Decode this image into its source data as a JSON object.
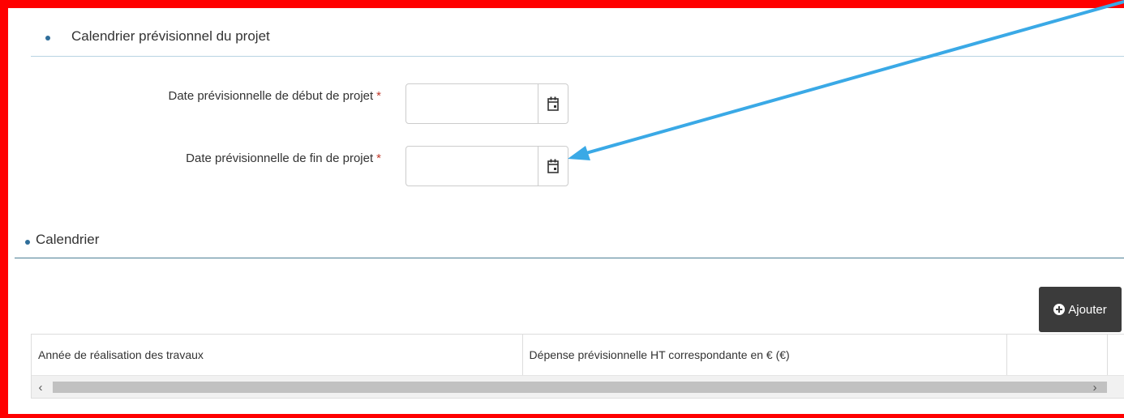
{
  "sections": {
    "projet": {
      "title": "Calendrier prévisionnel du projet"
    },
    "calendrier": {
      "title": "Calendrier"
    }
  },
  "fields": {
    "start": {
      "label": "Date prévisionnelle de début de projet",
      "required_mark": "*",
      "value": ""
    },
    "end": {
      "label": "Date prévisionnelle de fin de projet",
      "required_mark": "*",
      "value": ""
    }
  },
  "toolbar": {
    "add_label": "Ajouter"
  },
  "table": {
    "columns": [
      "Année de réalisation des travaux",
      "Dépense prévisionnelle HT correspondante en € (€)",
      ""
    ],
    "rows": []
  },
  "icons": {
    "calendar": "calendar-icon",
    "add": "plus-circle-icon",
    "scroll_left": "chevron-left-icon",
    "scroll_right": "chevron-right-icon"
  },
  "colors": {
    "highlight_frame": "#ff0000",
    "annotation_arrow": "#3aa9e6",
    "required": "#c0392b",
    "button_bg": "#3b3b3b",
    "section_bullet": "#2f6e9a"
  }
}
